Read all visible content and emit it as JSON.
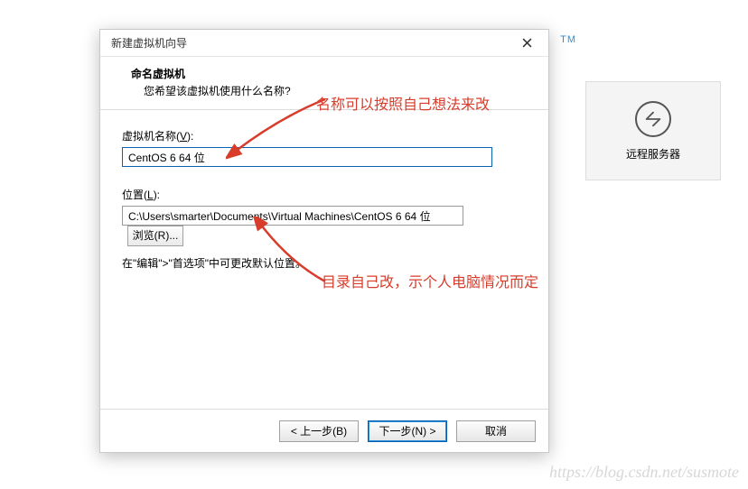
{
  "background": {
    "tm_text": "TM",
    "tile_label": "远程服务器"
  },
  "dialog": {
    "title": "新建虚拟机向导",
    "header": {
      "title": "命名虚拟机",
      "subtitle": "您希望该虚拟机使用什么名称?"
    },
    "name": {
      "label_prefix": "虚拟机名称(",
      "label_accel": "V",
      "label_suffix": "):",
      "value": "CentOS 6 64 位"
    },
    "location": {
      "label_prefix": "位置(",
      "label_accel": "L",
      "label_suffix": "):",
      "value": "C:\\Users\\smarter\\Documents\\Virtual Machines\\CentOS 6 64 位",
      "browse": "浏览(R)..."
    },
    "hint": "在\"编辑\">\"首选项\"中可更改默认位置。",
    "buttons": {
      "back": "< 上一步(B)",
      "next": "下一步(N) >",
      "cancel": "取消"
    }
  },
  "annotations": {
    "a1": "名称可以按照自己想法来改",
    "a2": "目录自己改，示个人电脑情况而定"
  },
  "watermark": "https://blog.csdn.net/susmote"
}
